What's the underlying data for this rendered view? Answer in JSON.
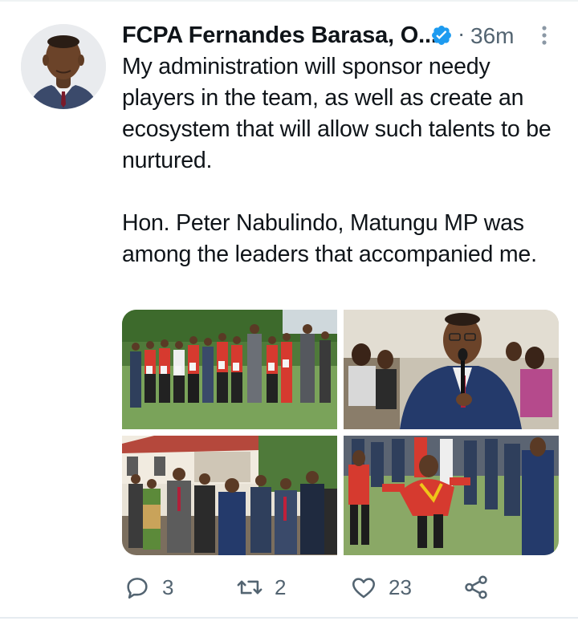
{
  "tweet": {
    "author": "FCPA Fernandes Barasa, O...",
    "separator": "·",
    "time": "36m",
    "text": "My administration will sponsor needy players in the team, as well as create an ecosystem that will allow such talents to be nurtured.\n\nHon. Peter Nabulindo, Matungu MP was among the leaders that accompanied me."
  },
  "actions": {
    "replies": "3",
    "retweets": "2",
    "likes": "23"
  },
  "colors": {
    "verified": "#1d9bf0",
    "secondary_text": "#536471",
    "text": "#0f1419"
  },
  "icons": [
    "verified-badge-icon",
    "more-vertical-icon",
    "reply-icon",
    "retweet-icon",
    "like-icon",
    "share-icon"
  ]
}
